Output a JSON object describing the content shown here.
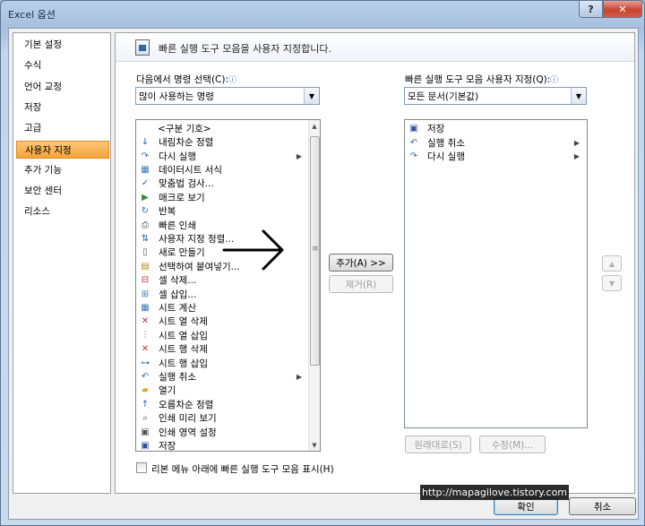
{
  "window": {
    "title": "Excel 옵션",
    "help_label": "?",
    "close_label": "✕"
  },
  "nav": {
    "items": [
      {
        "label": "기본 설정",
        "active": false
      },
      {
        "label": "수식",
        "active": false
      },
      {
        "label": "언어 교정",
        "active": false
      },
      {
        "label": "저장",
        "active": false
      },
      {
        "label": "고급",
        "active": false
      },
      {
        "label": "사용자 지정",
        "active": true
      },
      {
        "label": "추가 기능",
        "active": false
      },
      {
        "label": "보안 센터",
        "active": false
      },
      {
        "label": "리소스",
        "active": false
      }
    ]
  },
  "header": {
    "icon": "quick-access-toolbar-icon",
    "text": "빠른 실행 도구 모음을 사용자 지정합니다."
  },
  "left": {
    "label": "다음에서 명령 선택(C):",
    "combo_value": "많이 사용하는 명령",
    "separator_label": "<구분 기호>",
    "commands": [
      {
        "label": "내림차순 정렬",
        "icon": "sort-descending-icon",
        "glyph": "↓",
        "color": "#1f5fae"
      },
      {
        "label": "다시 실행",
        "icon": "redo-icon",
        "glyph": "↷",
        "color": "#2a6cc0",
        "submenu": true
      },
      {
        "label": "데이터시트 서식",
        "icon": "datasheet-format-icon",
        "glyph": "▦",
        "color": "#3b78b4"
      },
      {
        "label": "맞춤법 검사...",
        "icon": "spelling-check-icon",
        "glyph": "✓",
        "color": "#2a5fa8"
      },
      {
        "label": "매크로 보기",
        "icon": "run-macro-icon",
        "glyph": "▶",
        "color": "#2f8a3c"
      },
      {
        "label": "반복",
        "icon": "repeat-icon",
        "glyph": "↻",
        "color": "#2a6cc0"
      },
      {
        "label": "빠른 인쇄",
        "icon": "quick-print-icon",
        "glyph": "⎙",
        "color": "#444444"
      },
      {
        "label": "사용자 지정 정렬...",
        "icon": "custom-sort-icon",
        "glyph": "⇅",
        "color": "#2a5fa8"
      },
      {
        "label": "새로 만들기",
        "icon": "new-document-icon",
        "glyph": "▯",
        "color": "#555555"
      },
      {
        "label": "선택하여 붙여넣기...",
        "icon": "paste-special-icon",
        "glyph": "▤",
        "color": "#b08820"
      },
      {
        "label": "셀 삭제...",
        "icon": "delete-cells-icon",
        "glyph": "⊟",
        "color": "#c03030"
      },
      {
        "label": "셀 삽입...",
        "icon": "insert-cells-icon",
        "glyph": "⊞",
        "color": "#3b78b4"
      },
      {
        "label": "시트 계산",
        "icon": "calculate-sheet-icon",
        "glyph": "▦",
        "color": "#3b78b4"
      },
      {
        "label": "시트 열 삭제",
        "icon": "delete-sheet-columns-icon",
        "glyph": "✕",
        "color": "#c03030"
      },
      {
        "label": "시트 열 삽입",
        "icon": "insert-sheet-columns-icon",
        "glyph": "⫶",
        "color": "#3b78b4"
      },
      {
        "label": "시트 행 삭제",
        "icon": "delete-sheet-rows-icon",
        "glyph": "✕",
        "color": "#c03030"
      },
      {
        "label": "시트 행 삽입",
        "icon": "insert-sheet-rows-icon",
        "glyph": "⊶",
        "color": "#3b78b4"
      },
      {
        "label": "실행 취소",
        "icon": "undo-icon",
        "glyph": "↶",
        "color": "#2a6cc0",
        "submenu": true
      },
      {
        "label": "열기",
        "icon": "open-folder-icon",
        "glyph": "▰",
        "color": "#d9a82a"
      },
      {
        "label": "오름차순 정렬",
        "icon": "sort-ascending-icon",
        "glyph": "↑",
        "color": "#1f5fae"
      },
      {
        "label": "인쇄 미리 보기",
        "icon": "print-preview-icon",
        "glyph": "⌕",
        "color": "#444444"
      },
      {
        "label": "인쇄 영역 설정",
        "icon": "set-print-area-icon",
        "glyph": "▣",
        "color": "#555555"
      },
      {
        "label": "저장",
        "icon": "save-icon",
        "glyph": "▣",
        "color": "#2d4f9c"
      }
    ],
    "checkbox_label": "리본 메뉴 아래에 빠른 실행 도구 모음 표시(H)"
  },
  "right": {
    "label": "빠른 실행 도구 모음 사용자 지정(Q):",
    "combo_value": "모든 문서(기본값)",
    "commands": [
      {
        "label": "저장",
        "icon": "save-icon",
        "glyph": "▣",
        "color": "#2d4f9c"
      },
      {
        "label": "실행 취소",
        "icon": "undo-icon",
        "glyph": "↶",
        "color": "#2a6cc0",
        "submenu": true
      },
      {
        "label": "다시 실행",
        "icon": "redo-icon",
        "glyph": "↷",
        "color": "#2a6cc0",
        "submenu": true
      }
    ]
  },
  "buttons": {
    "add": "추가(A) >>",
    "remove": "제거(R)",
    "reset": "원래대로(S)",
    "modify": "수정(M)...",
    "ok": "확인",
    "cancel": "취소"
  },
  "watermark": "http://mapagilove.tistory.com"
}
